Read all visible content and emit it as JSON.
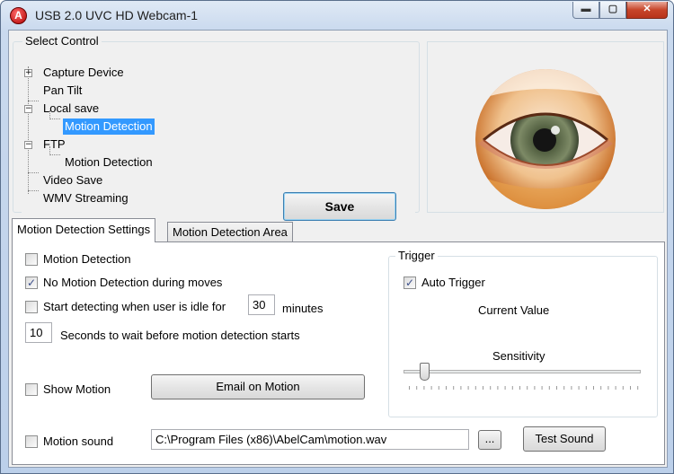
{
  "window": {
    "title": "USB 2.0 UVC HD Webcam-1",
    "app_icon": "abelcam-icon",
    "app_icon_glyph": "A"
  },
  "caption": {
    "minimize": "▬",
    "maximize": "▢",
    "close": "✕"
  },
  "select_control": {
    "label": "Select Control",
    "tree": [
      {
        "label": "Capture Device",
        "expander": "+"
      },
      {
        "label": "Pan Tilt"
      },
      {
        "label": "Local save",
        "expander": "−"
      },
      {
        "label": "Motion Detection",
        "selected": true
      },
      {
        "label": "FTP",
        "expander": "−"
      },
      {
        "label": "Motion Detection"
      },
      {
        "label": "Video Save"
      },
      {
        "label": "WMV Streaming"
      }
    ],
    "save_label": "Save"
  },
  "tabs": [
    {
      "label": "Motion Detection Settings",
      "active": true
    },
    {
      "label": "Motion Detection Area",
      "active": false
    }
  ],
  "settings": {
    "motion_detection": {
      "label": "Motion Detection",
      "checked": false
    },
    "no_motion_during_moves": {
      "label": "No Motion Detection during moves",
      "checked": true,
      "check_glyph": "✓"
    },
    "idle_start": {
      "label": "Start detecting when user is idle for",
      "checked": false,
      "value": "30",
      "unit": "minutes"
    },
    "wait_seconds": {
      "value": "10",
      "label": "Seconds to wait before motion detection starts"
    },
    "show_motion": {
      "label": "Show Motion",
      "checked": false
    },
    "email_on_motion": "Email on Motion",
    "motion_sound": {
      "label": "Motion sound",
      "checked": false,
      "path": "C:\\Program Files (x86)\\AbelCam\\motion.wav",
      "browse": "...",
      "test": "Test Sound"
    }
  },
  "trigger": {
    "label": "Trigger",
    "auto_trigger": {
      "label": "Auto Trigger",
      "checked": true,
      "check_glyph": "✓"
    },
    "current_value_label": "Current Value",
    "sensitivity_label": "Sensitivity"
  },
  "colors": {
    "selection": "#3399ff",
    "close_button": "#c7452a",
    "iris": "#6d7a56"
  }
}
